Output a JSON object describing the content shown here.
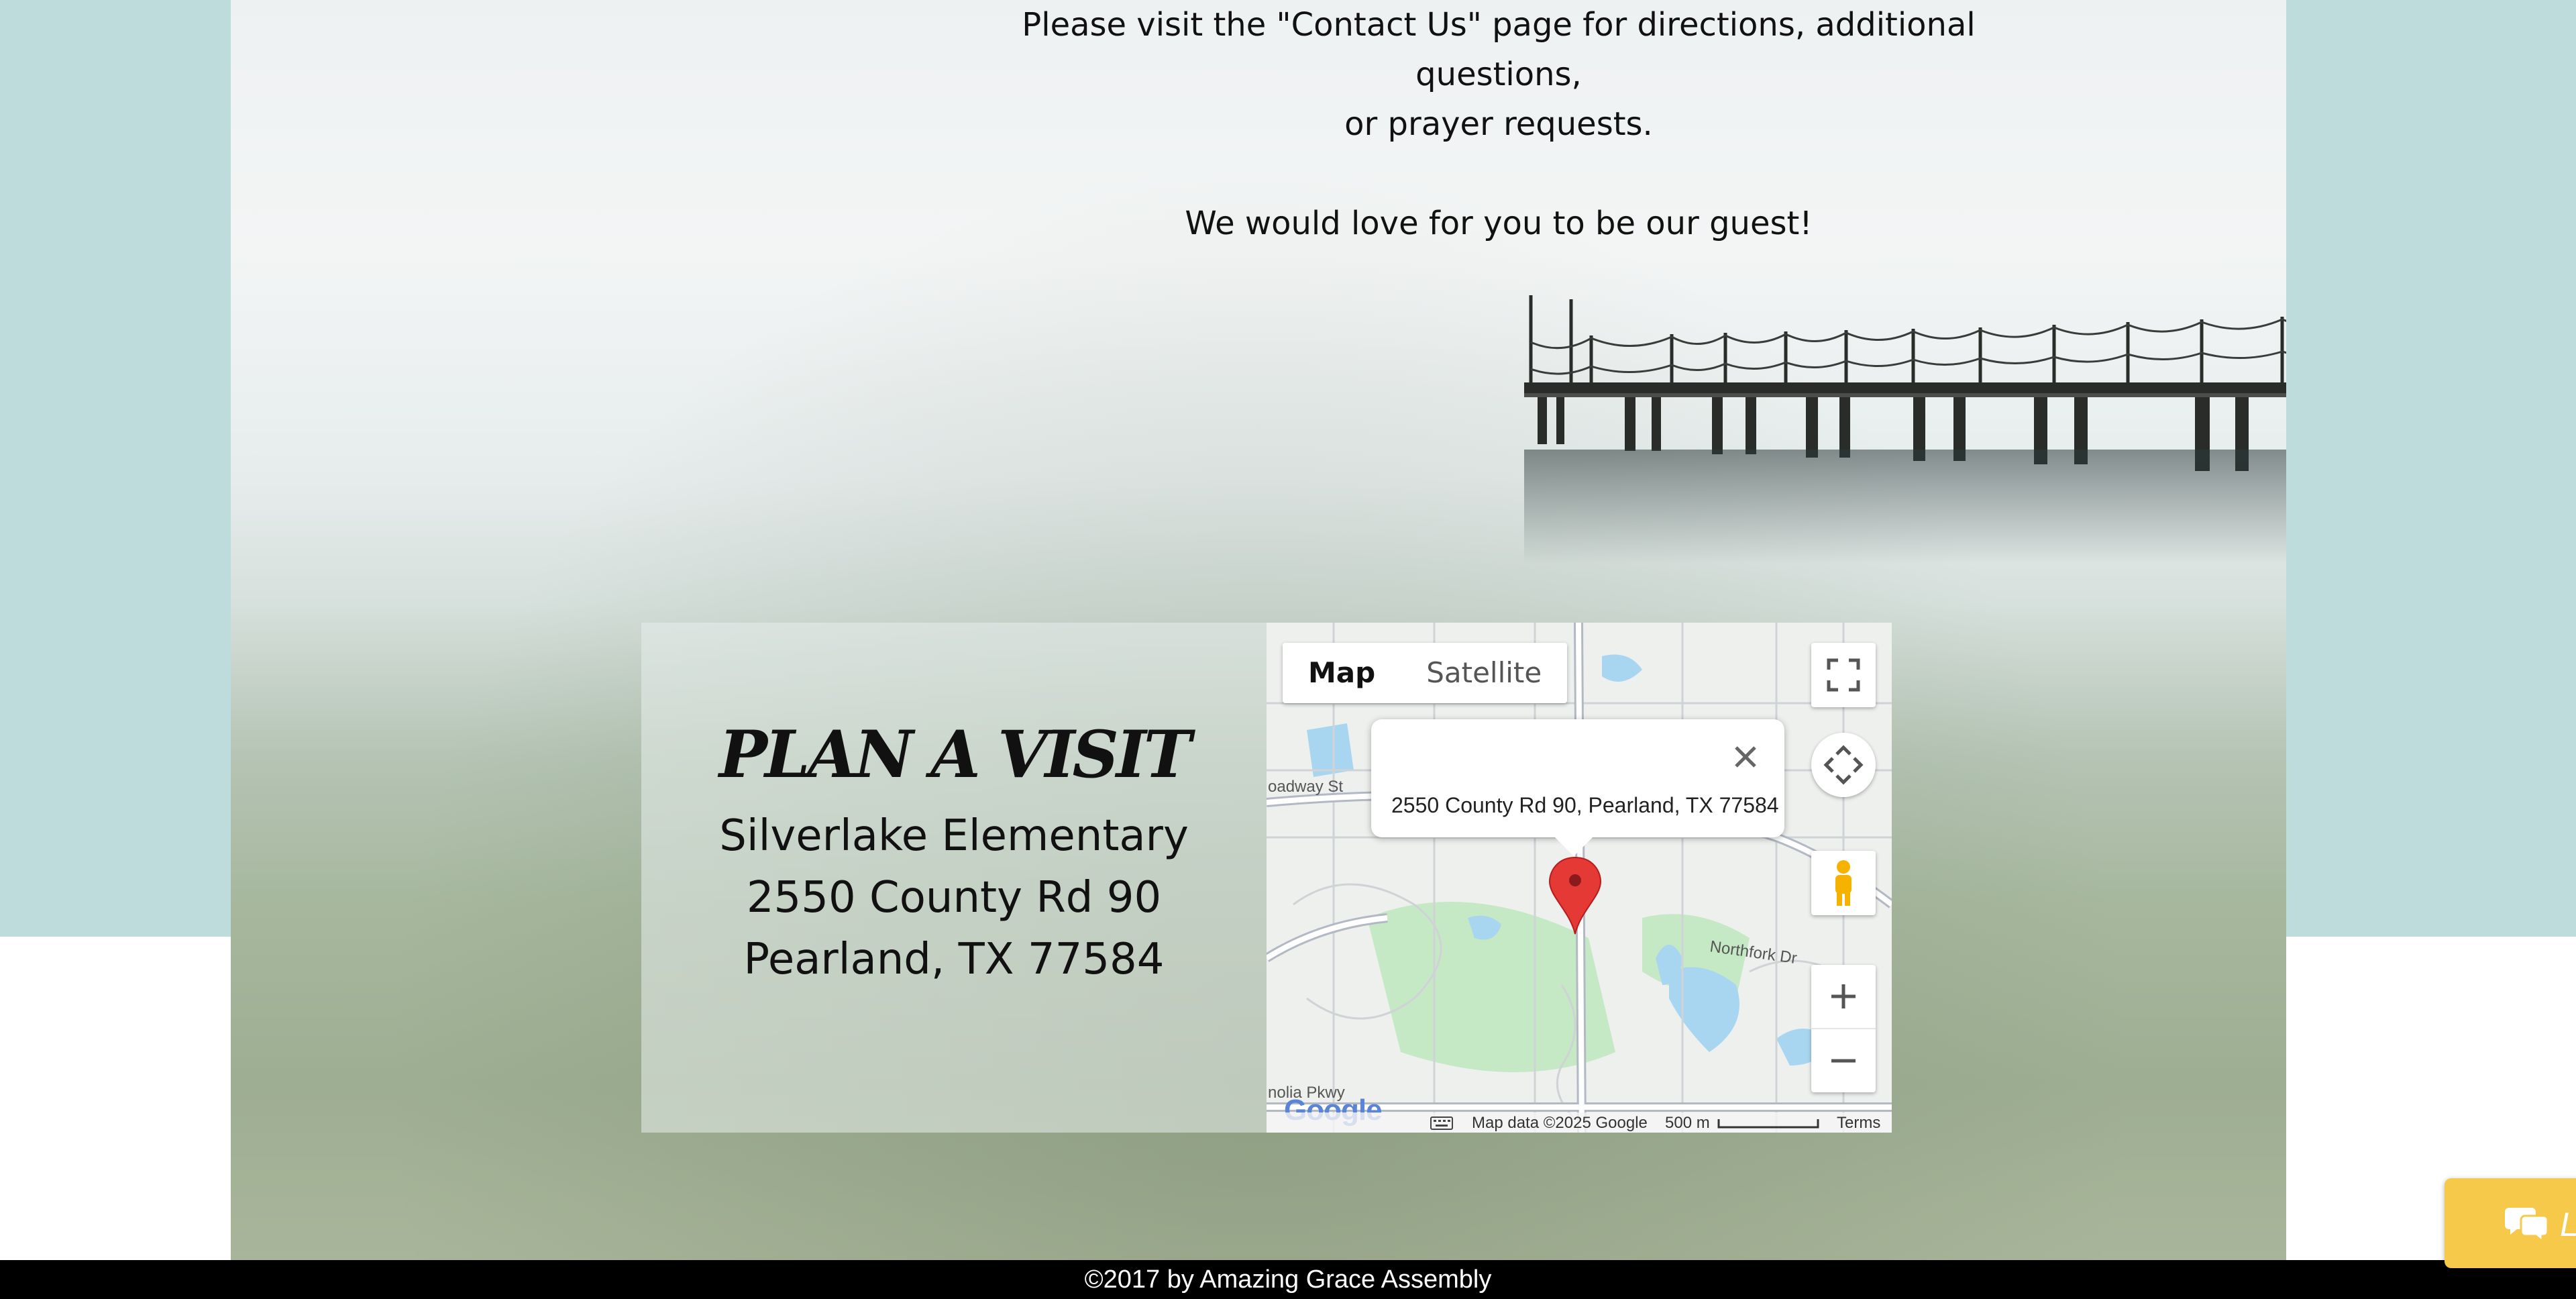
{
  "intro": {
    "line1": "Please visit the \"Contact Us\" page for directions, additional questions,",
    "line2": "or prayer requests.",
    "line3": "We would love for you to be our guest!"
  },
  "plan": {
    "title": "PLAN A VISIT",
    "address_lines": [
      "Silverlake Elementary",
      "2550 County Rd 90",
      "Pearland, TX 77584"
    ]
  },
  "map": {
    "tabs": [
      {
        "label": "Map",
        "active": true
      },
      {
        "label": "Satellite",
        "active": false
      }
    ],
    "info_address": "2550 County Rd 90, Pearland, TX 77584",
    "street_labels": [
      "oadway St",
      "Northfork Dr",
      "nolia Pkwy"
    ],
    "google_logo": "Google",
    "map_data": "Map data ©2025 Google",
    "scale": "500 m",
    "terms": "Terms",
    "colors": {
      "water": "#a8d6f0",
      "park": "#c5e8c5",
      "road": "#ffffff",
      "pin": "#e53935"
    }
  },
  "footer": {
    "copyright": "©2017 by Amazing Grace Assembly"
  },
  "chat": {
    "label": "L"
  },
  "colors": {
    "teal_band": "#bfdcdc",
    "chat_accent": "#f6c94a"
  }
}
